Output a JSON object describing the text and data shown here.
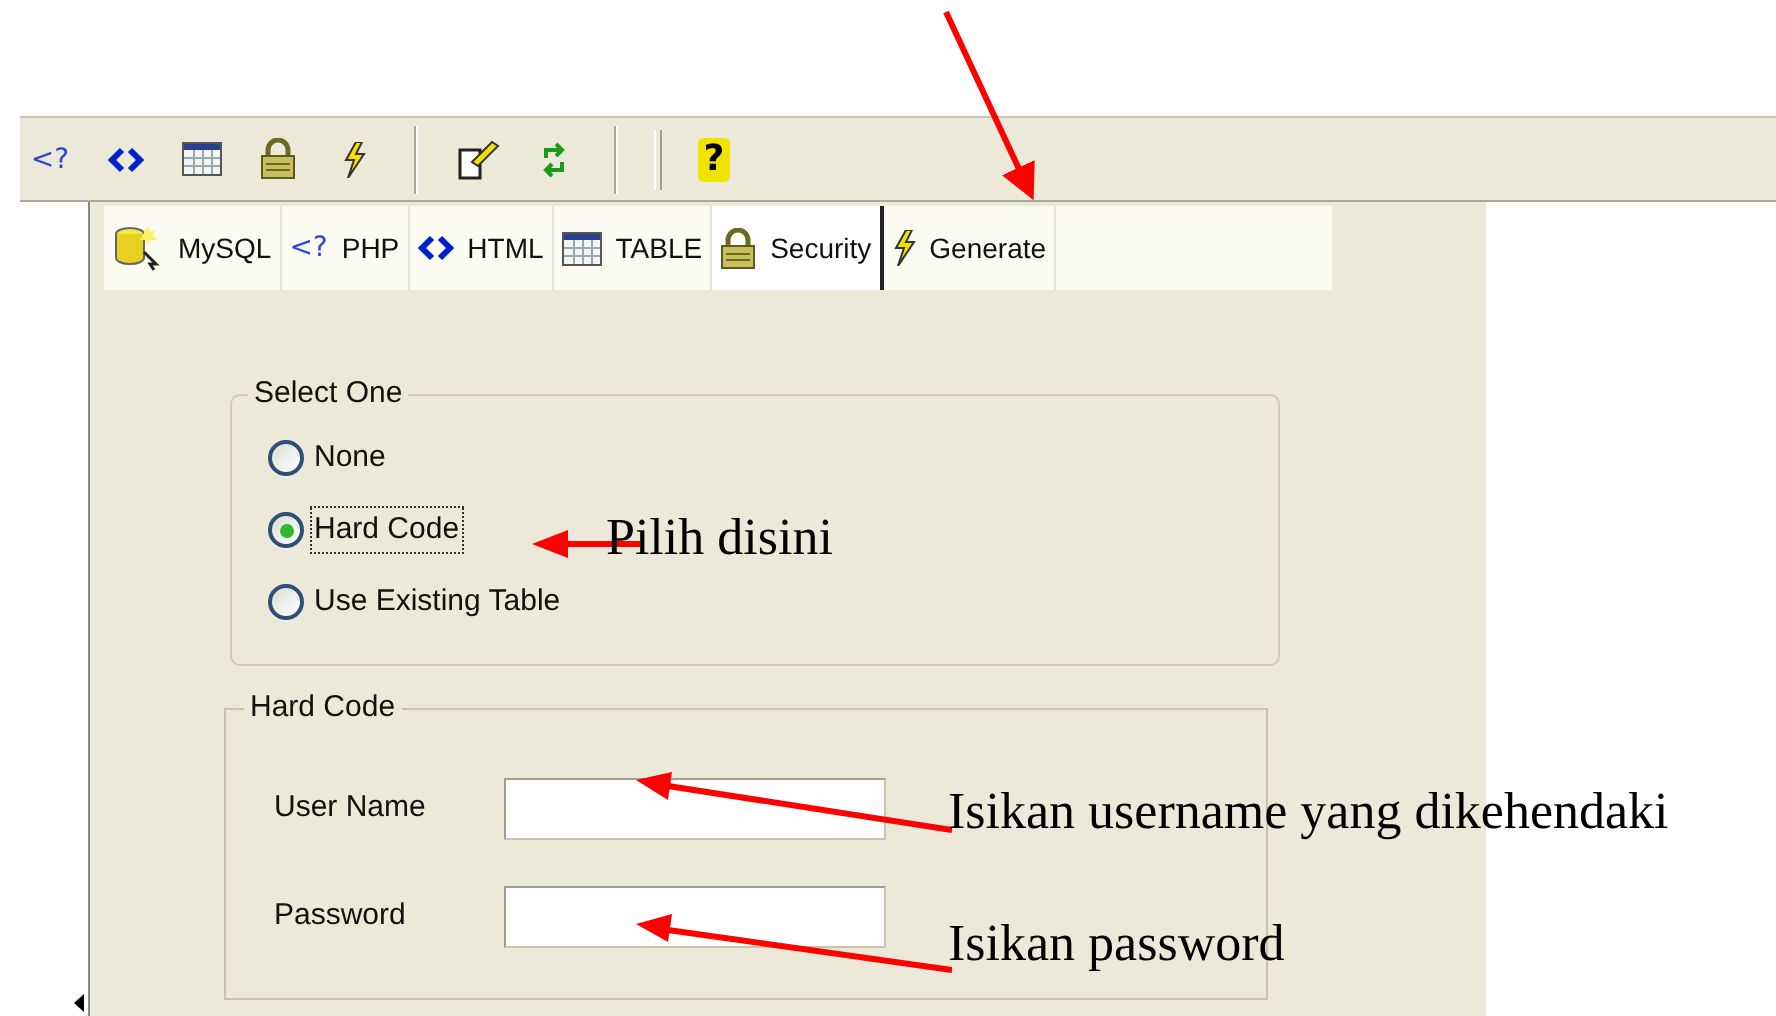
{
  "toolbar": [
    {
      "kind": "php",
      "glyph": "<?"
    },
    {
      "kind": "html"
    },
    {
      "kind": "table"
    },
    {
      "kind": "lock"
    },
    {
      "kind": "bolt"
    },
    {
      "kind": "separator"
    },
    {
      "kind": "edit"
    },
    {
      "kind": "refresh"
    },
    {
      "kind": "separator"
    },
    {
      "kind": "grip"
    },
    {
      "kind": "help",
      "glyph": "?"
    }
  ],
  "tabs": [
    {
      "label": "MySQL",
      "kind": "database",
      "selected": false
    },
    {
      "label": "PHP",
      "kind": "php",
      "glyph": "<?",
      "selected": false
    },
    {
      "label": "HTML",
      "kind": "html",
      "selected": false
    },
    {
      "label": "TABLE",
      "kind": "table",
      "selected": false
    },
    {
      "label": "Security",
      "kind": "lock",
      "selected": true
    },
    {
      "label": "Generate",
      "kind": "bolt",
      "selected": false
    }
  ],
  "select_group": {
    "title": "Select One",
    "options": [
      {
        "label": "None",
        "selected": false,
        "focused": false
      },
      {
        "label": "Hard Code",
        "selected": true,
        "focused": true
      },
      {
        "label": "Use Existing Table",
        "selected": false,
        "focused": false
      }
    ]
  },
  "hard_code_group": {
    "title": "Hard Code",
    "fields": [
      {
        "label": "User Name"
      },
      {
        "label": "Password"
      }
    ]
  },
  "annotations": [
    {
      "kind": "tab"
    },
    {
      "kind": "option",
      "text": "Pilih disini"
    },
    {
      "kind": "username",
      "text": "Isikan username yang dikehendaki"
    },
    {
      "kind": "password",
      "text": "Isikan password"
    }
  ]
}
